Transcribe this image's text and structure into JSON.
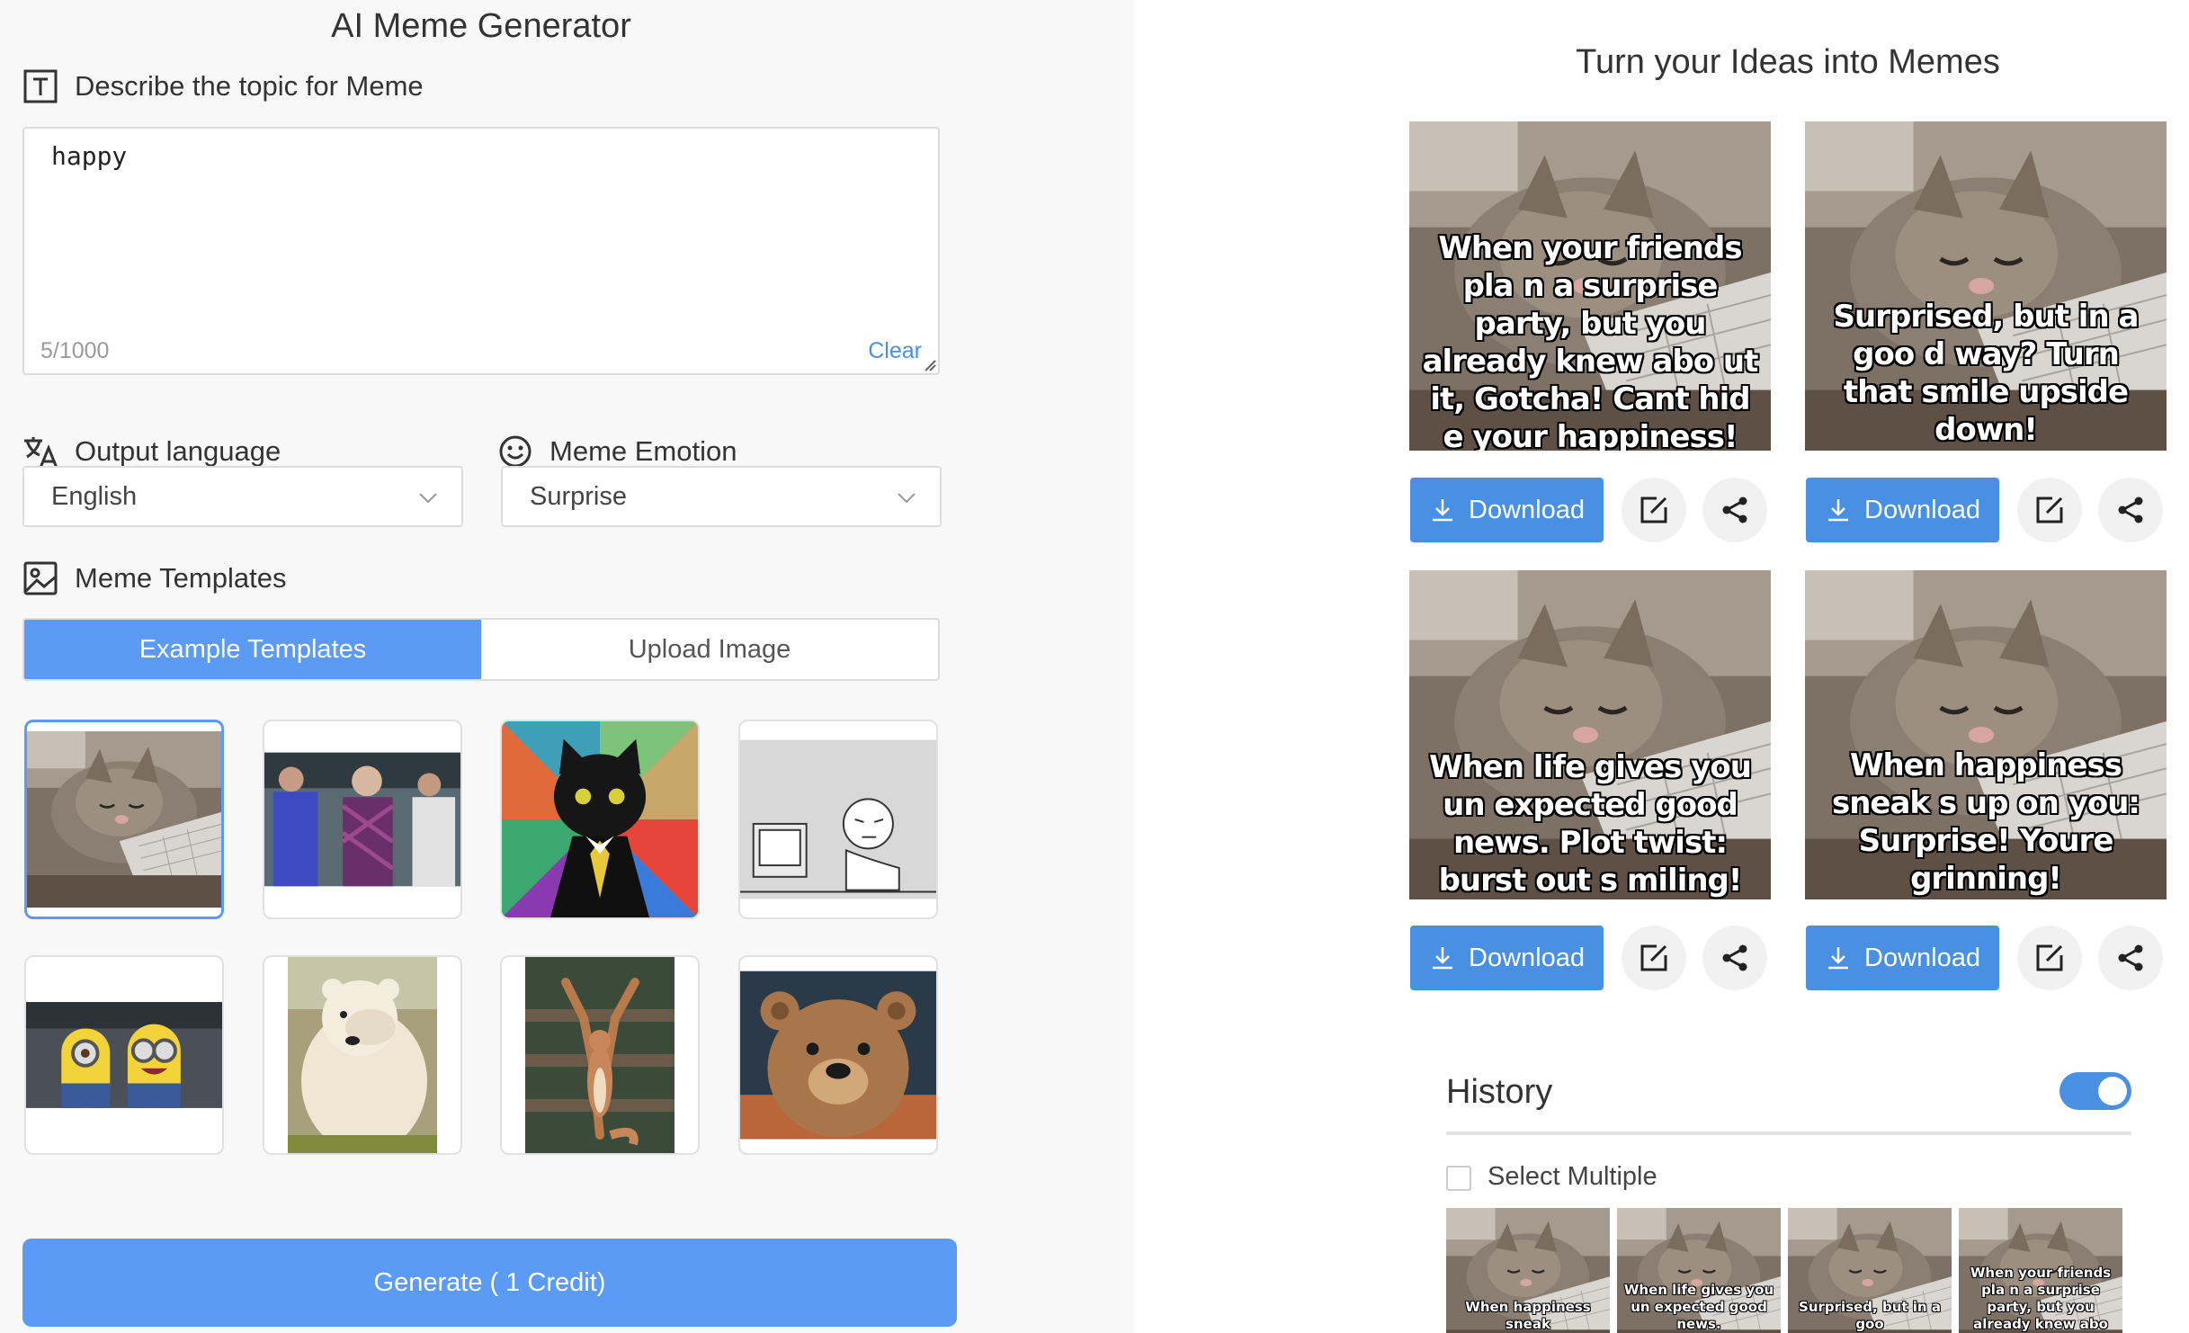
{
  "app": {
    "title": "AI Meme Generator"
  },
  "topic": {
    "heading": "Describe the topic for Meme",
    "value": "happy",
    "counter": "5/1000",
    "clear_label": "Clear"
  },
  "language": {
    "heading": "Output language",
    "selected": "English"
  },
  "emotion": {
    "heading": "Meme Emotion",
    "selected": "Surprise"
  },
  "templates": {
    "heading": "Meme Templates",
    "tabs": [
      "Example Templates",
      "Upload Image"
    ],
    "active_tab": "Example Templates",
    "items": [
      "sleepy-kitten",
      "confused-man",
      "business-cat",
      "computer-guy-rage",
      "minions",
      "facepalm-bear",
      "cheering-squirrel",
      "teddy-bear"
    ],
    "selected_index": 0
  },
  "generate": {
    "label": "Generate ( 1 Credit)"
  },
  "results": {
    "title": "Turn your Ideas into Memes",
    "memes": [
      {
        "caption": "When your friends pla n a surprise party, but you already knew abo ut it, Gotcha! Cant hid e your happiness!"
      },
      {
        "caption": "Surprised, but in a goo d way? Turn that smile upside down!"
      },
      {
        "caption": "When life gives you un expected good news. Plot twist: burst out s miling!"
      },
      {
        "caption": "When happiness sneak s up on you: Surprise! Youre grinning!"
      }
    ],
    "download_label": "Download"
  },
  "history": {
    "title": "History",
    "toggle_on": true,
    "select_multiple_label": "Select Multiple",
    "items": [
      {
        "caption": "When happiness sneak"
      },
      {
        "caption": "When life gives you un expected good news."
      },
      {
        "caption": "Surprised, but in a goo"
      },
      {
        "caption": "When your friends pla n a surprise party, but you already knew abo"
      }
    ]
  },
  "colors": {
    "accent": "#5b9bf5",
    "button_blue": "#4a90e2",
    "left_bg": "#f8f8f8"
  }
}
